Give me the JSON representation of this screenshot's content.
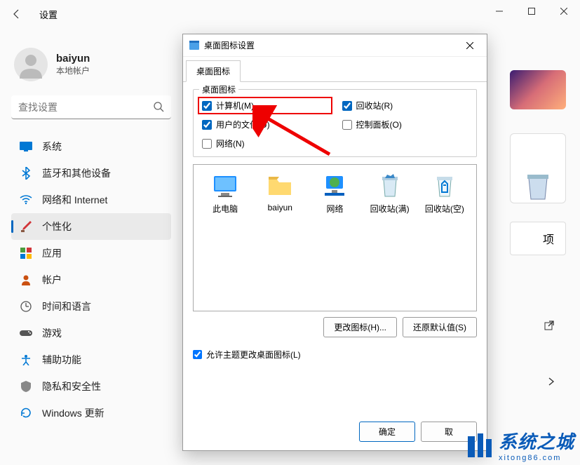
{
  "window": {
    "title": "设置",
    "user": {
      "name": "baiyun",
      "type": "本地帐户"
    },
    "search_placeholder": "查找设置",
    "nav": [
      {
        "id": "system",
        "label": "系统",
        "color": "#0078d4"
      },
      {
        "id": "bluetooth",
        "label": "蓝牙和其他设备",
        "color": "#0078d4"
      },
      {
        "id": "network",
        "label": "网络和 Internet",
        "color": "#0078d4"
      },
      {
        "id": "personalization",
        "label": "个性化",
        "color": "#d13438",
        "active": true
      },
      {
        "id": "apps",
        "label": "应用",
        "color": "#555"
      },
      {
        "id": "accounts",
        "label": "帐户",
        "color": "#ca5010"
      },
      {
        "id": "time",
        "label": "时间和语言",
        "color": "#555"
      },
      {
        "id": "gaming",
        "label": "游戏",
        "color": "#555"
      },
      {
        "id": "accessibility",
        "label": "辅助功能",
        "color": "#0078d4"
      },
      {
        "id": "privacy",
        "label": "隐私和安全性",
        "color": "#555"
      },
      {
        "id": "update",
        "label": "Windows 更新",
        "color": "#0078d4"
      }
    ],
    "content_trailing": "项"
  },
  "dialog": {
    "title": "桌面图标设置",
    "tab": "桌面图标",
    "group_title": "桌面图标",
    "checkboxes": {
      "computer": {
        "label": "计算机(M)",
        "checked": true,
        "highlighted": true
      },
      "recycle": {
        "label": "回收站(R)",
        "checked": true
      },
      "userfiles": {
        "label": "用户的文件(U)",
        "checked": true
      },
      "controlpanel": {
        "label": "控制面板(O)",
        "checked": false
      },
      "network": {
        "label": "网络(N)",
        "checked": false
      }
    },
    "icons": [
      {
        "id": "thispc",
        "label": "此电脑"
      },
      {
        "id": "userfolder",
        "label": "baiyun"
      },
      {
        "id": "network",
        "label": "网络"
      },
      {
        "id": "recyclefull",
        "label": "回收站(满)"
      },
      {
        "id": "recycleempty",
        "label": "回收站(空)"
      }
    ],
    "buttons": {
      "change_icon": "更改图标(H)...",
      "restore_default": "还原默认值(S)",
      "allow_theme": "允许主题更改桌面图标(L)",
      "ok": "确定",
      "cancel": "取"
    }
  },
  "watermark": {
    "main": "系统之城",
    "sub": "xitong86.com"
  }
}
